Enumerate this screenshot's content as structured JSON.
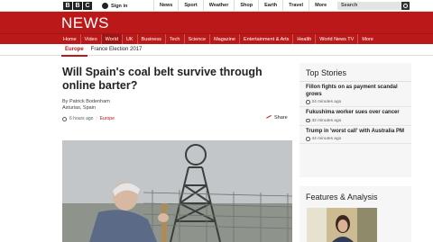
{
  "topbar": {
    "logo_letters": [
      "B",
      "B",
      "C"
    ],
    "signin_label": "Sign in",
    "nav": [
      "News",
      "Sport",
      "Weather",
      "Shop",
      "Earth",
      "Travel",
      "More"
    ],
    "search_placeholder": "Search"
  },
  "news": {
    "title": "NEWS",
    "nav": [
      "Home",
      "Video",
      "World",
      "UK",
      "Business",
      "Tech",
      "Science",
      "Magazine",
      "Entertainment & Arts",
      "Health",
      "World News TV",
      "More"
    ],
    "active_nav": "World",
    "subnav": [
      "Europe",
      "France Election 2017"
    ],
    "active_subnav": "Europe"
  },
  "article": {
    "headline": "Will Spain's coal belt survive through online barter?",
    "author": "By Patrick Bodenham",
    "location": "Asturias, Spain",
    "time_ago": "6 hours ago",
    "separator": "|",
    "category": "Europe",
    "share_label": "Share"
  },
  "top_stories": {
    "heading": "Top Stories",
    "items": [
      {
        "title": "Fillon fights on as payment scandal grows",
        "time": "24 minutes ago"
      },
      {
        "title": "Fukushima worker sues over cancer",
        "time": "32 minutes ago"
      },
      {
        "title": "Trump in 'worst call' with Australia PM",
        "time": "44 minutes ago"
      }
    ]
  },
  "features": {
    "heading": "Features & Analysis"
  },
  "colors": {
    "brand_red": "#bb1919",
    "panel_bg": "#f6f6f6"
  }
}
